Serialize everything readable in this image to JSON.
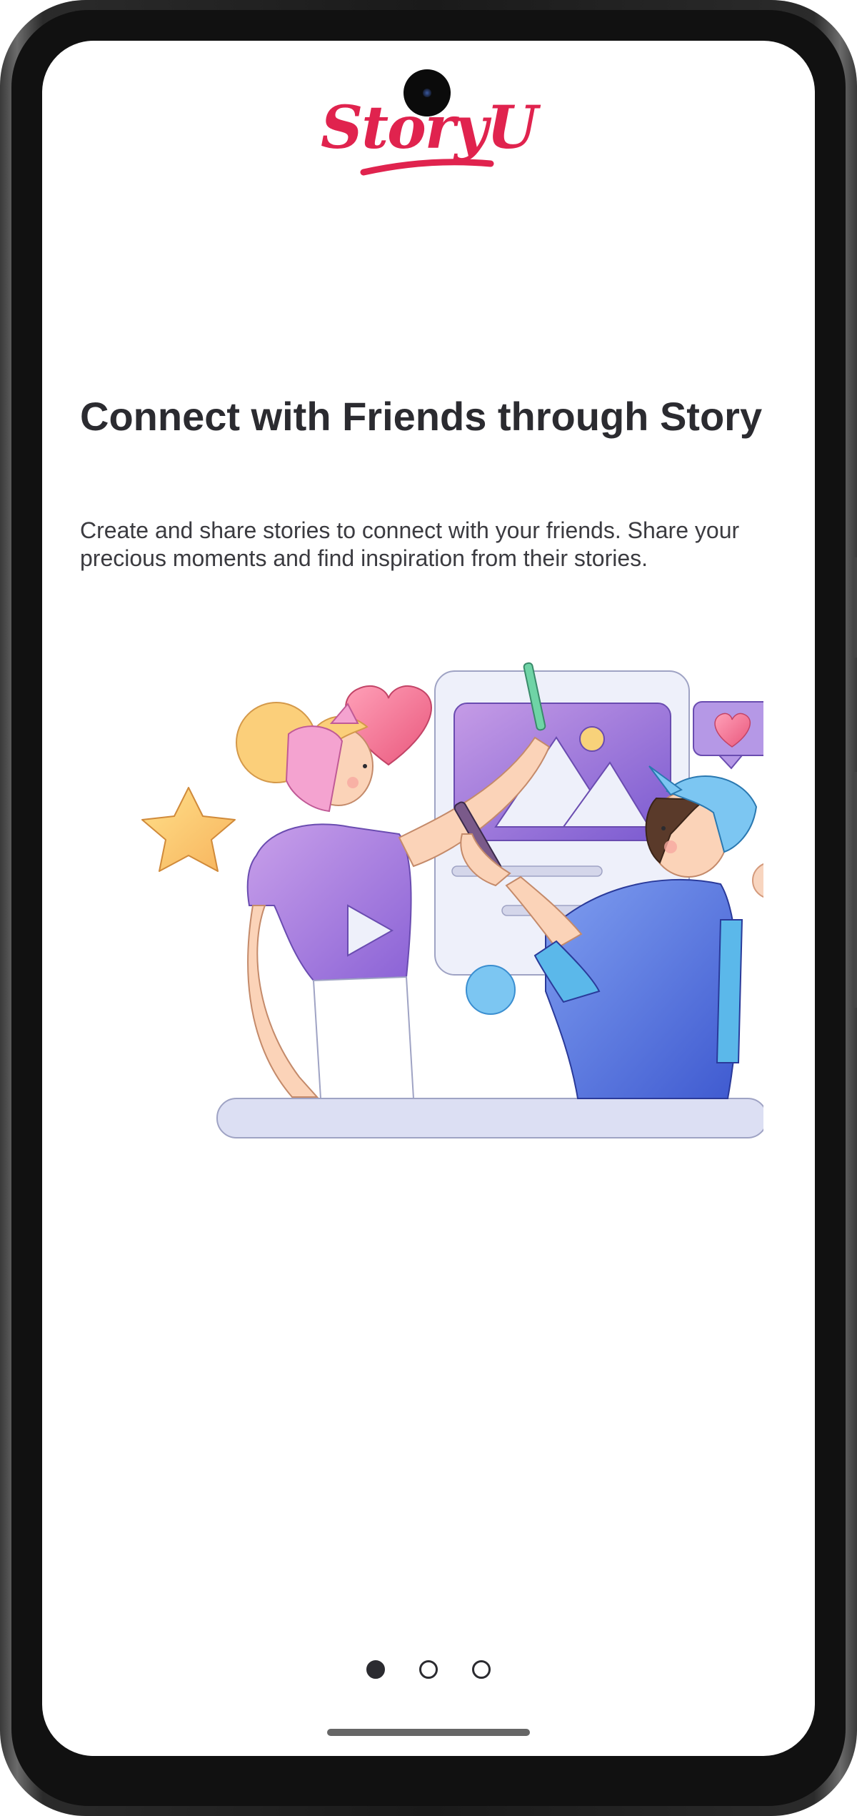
{
  "app": {
    "logo_text": "StoryU"
  },
  "onboarding": {
    "title": "Connect with Friends through Story",
    "description": "Create and share stories to connect with your friends. Share your precious moments and find inspiration from their stories.",
    "illustration": "two-friends-sharing-story-illustration"
  },
  "pager": {
    "dots": [
      {
        "label": "page-1",
        "active": true
      },
      {
        "label": "page-2",
        "active": false
      },
      {
        "label": "page-3",
        "active": false
      }
    ],
    "current_page": 1,
    "total_pages": 3
  },
  "colors": {
    "brand": "#e0234e",
    "text_primary": "#2b2b30",
    "text_secondary": "#3b3b40",
    "purple": "#7b55c9",
    "pink": "#f06b8a",
    "blue": "#5b7fe6",
    "light_blue": "#5bb8ea",
    "yellow": "#fbc96b"
  }
}
